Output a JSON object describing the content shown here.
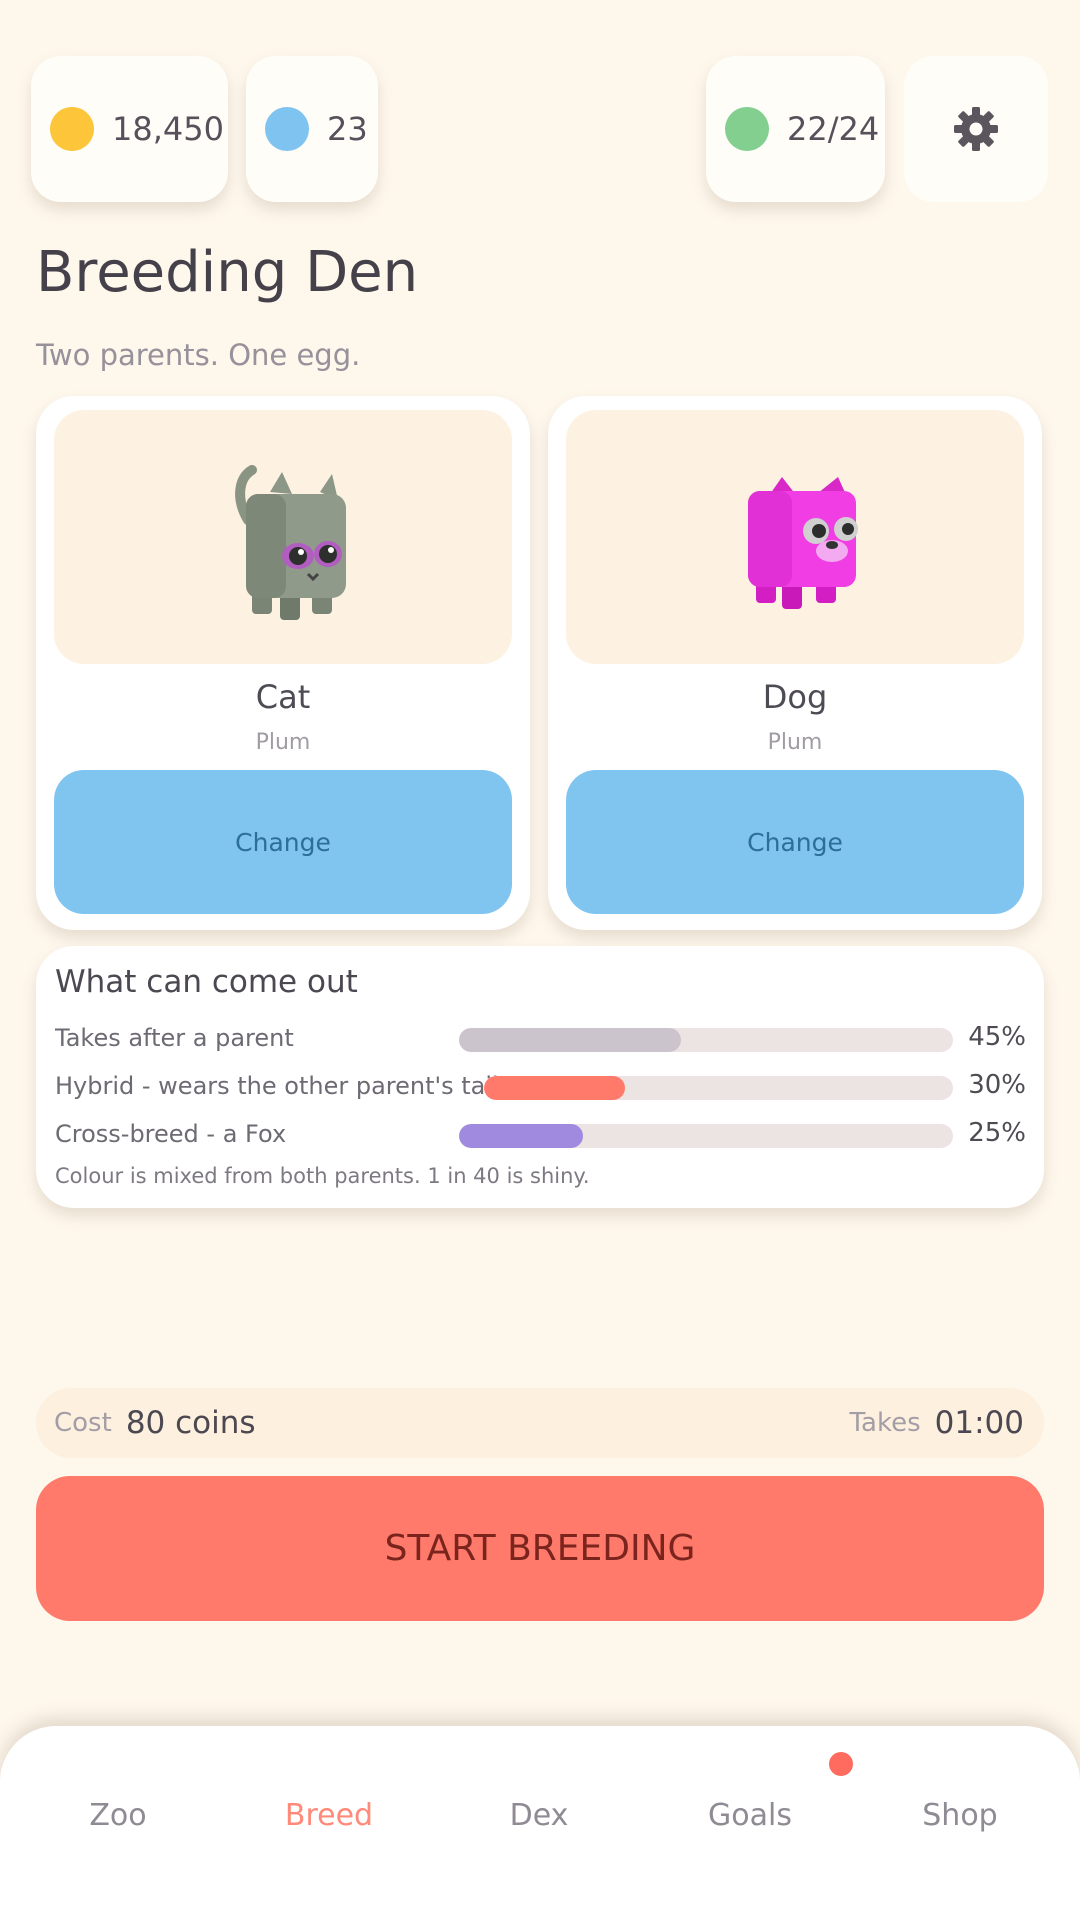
{
  "topbar": {
    "coins": {
      "value": "18,450",
      "color": "#fcc53a"
    },
    "gems": {
      "value": "23",
      "color": "#7fc4f0"
    },
    "pets": {
      "value": "22/24",
      "color": "#82cf90"
    },
    "settings_icon": "gear-icon"
  },
  "page": {
    "title": "Breeding Den",
    "subtitle": "Two parents. One egg."
  },
  "parents": [
    {
      "species": "Cat",
      "colour": "Plum",
      "change_label": "Change",
      "portrait_icon": "cat-figure"
    },
    {
      "species": "Dog",
      "colour": "Plum",
      "change_label": "Change",
      "portrait_icon": "dog-figure"
    }
  ],
  "odds": {
    "title": "What can come out",
    "rows": [
      {
        "label": "Takes after a parent",
        "percent_text": "45%",
        "percent": 45,
        "color": "#cbc4cd"
      },
      {
        "label": "Hybrid - wears the other parent's tail",
        "percent_text": "30%",
        "percent": 30,
        "color": "#ff7a6b"
      },
      {
        "label": "Cross-breed - a Fox",
        "percent_text": "25%",
        "percent": 25,
        "color": "#a08ae0"
      }
    ],
    "note": "Colour is mixed from both parents. 1 in 40 is shiny."
  },
  "cost": {
    "cost_label": "Cost",
    "cost_value": "80 coins",
    "time_label": "Takes",
    "time_value": "01:00"
  },
  "start_button": "START BREEDING",
  "nav": {
    "items": [
      "Zoo",
      "Breed",
      "Dex",
      "Goals",
      "Shop"
    ],
    "active": "Breed",
    "badge_item": "Goals",
    "badge_color": "#ff6b5f"
  }
}
